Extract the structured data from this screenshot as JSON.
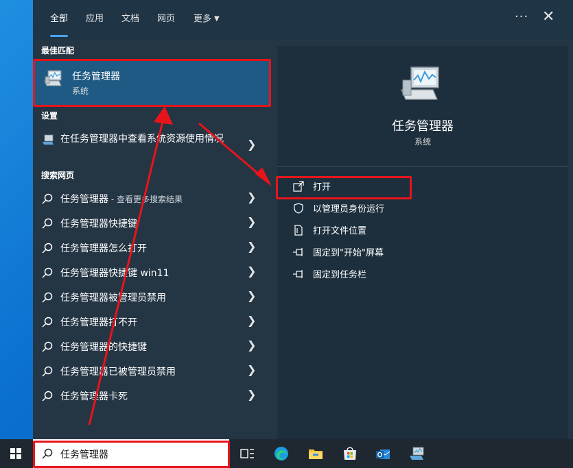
{
  "tabs": [
    {
      "label": "全部",
      "active": true
    },
    {
      "label": "应用",
      "active": false
    },
    {
      "label": "文档",
      "active": false
    },
    {
      "label": "网页",
      "active": false
    },
    {
      "label": "更多",
      "active": false
    }
  ],
  "toolbar": {
    "more_glyph": "···",
    "close_glyph": "✕"
  },
  "best_match": {
    "section_label": "最佳匹配",
    "title": "任务管理器",
    "subtitle": "系统"
  },
  "settings": {
    "section_label": "设置",
    "item": "在任务管理器中查看系统资源使用情况"
  },
  "web": {
    "section_label": "搜索网页",
    "items": [
      {
        "label": "任务管理器",
        "hint": " - 查看更多搜索结果"
      },
      {
        "label": "任务管理器快捷键",
        "hint": ""
      },
      {
        "label": "任务管理器怎么打开",
        "hint": ""
      },
      {
        "label": "任务管理器快捷键 win11",
        "hint": ""
      },
      {
        "label": "任务管理器被管理员禁用",
        "hint": ""
      },
      {
        "label": "任务管理器打不开",
        "hint": ""
      },
      {
        "label": "任务管理器的快捷键",
        "hint": ""
      },
      {
        "label": "任务管理器已被管理员禁用",
        "hint": ""
      },
      {
        "label": "任务管理器卡死",
        "hint": ""
      }
    ]
  },
  "detail": {
    "title": "任务管理器",
    "subtitle": "系统",
    "actions": [
      {
        "label": "打开",
        "icon": "open-icon"
      },
      {
        "label": "以管理员身份运行",
        "icon": "shield-icon"
      },
      {
        "label": "打开文件位置",
        "icon": "file-location-icon"
      },
      {
        "label": "固定到\"开始\"屏幕",
        "icon": "pin-icon"
      },
      {
        "label": "固定到任务栏",
        "icon": "pin-icon"
      }
    ]
  },
  "taskbar": {
    "search_value": "任务管理器",
    "icons": [
      "windows-logo-icon",
      "task-view-icon",
      "edge-icon",
      "file-explorer-icon",
      "store-icon",
      "outlook-icon",
      "task-manager-icon"
    ]
  },
  "colors": {
    "annotation": "#e8141b",
    "accent": "#4aa3f0",
    "selected": "#1e5a83"
  }
}
